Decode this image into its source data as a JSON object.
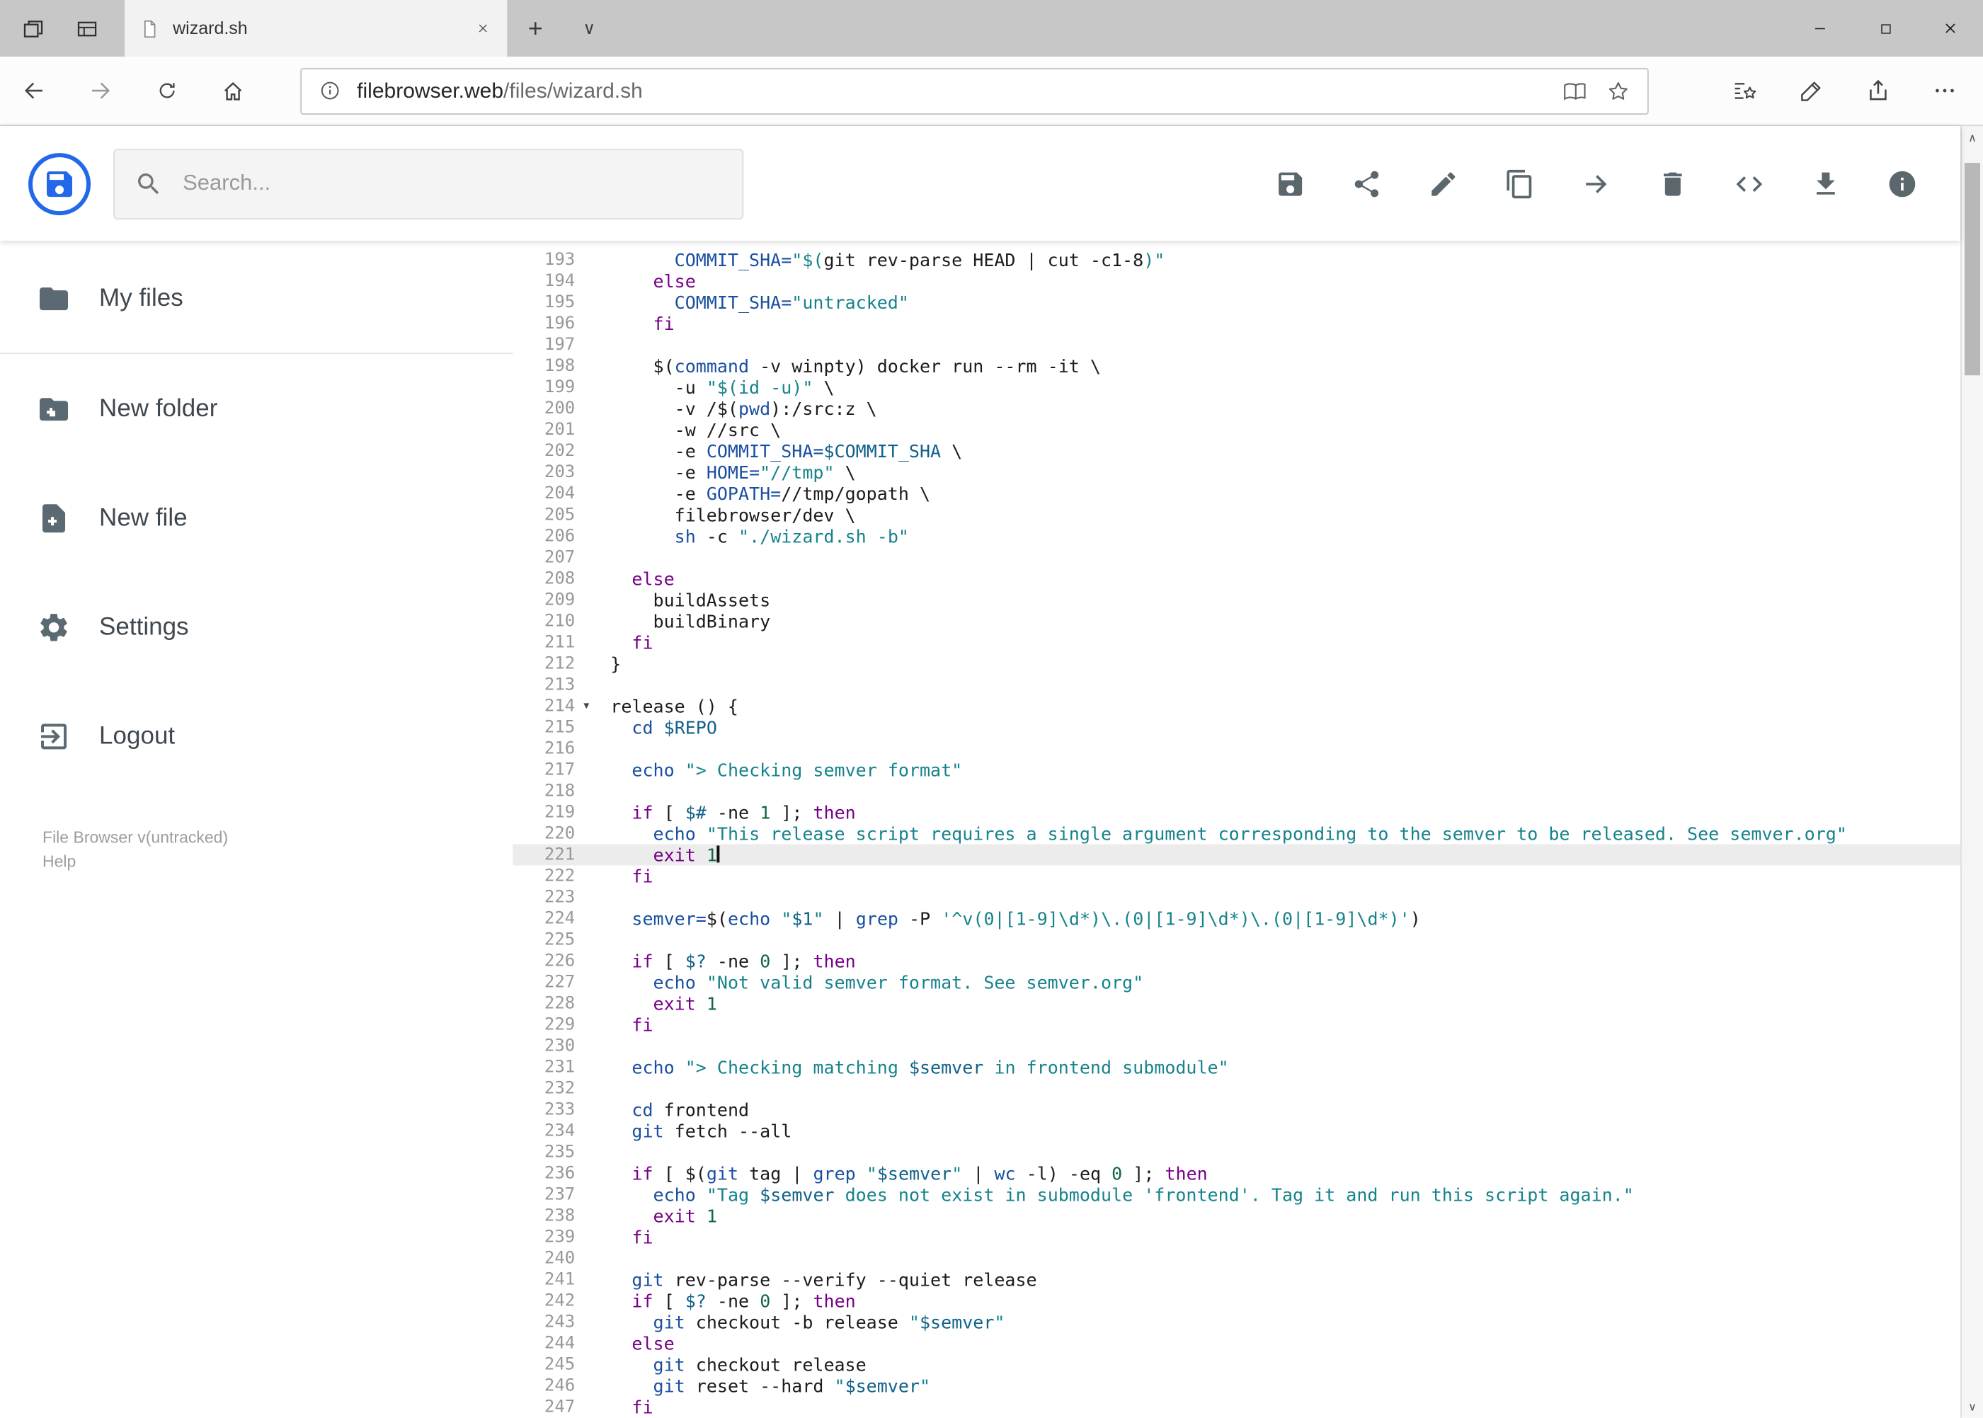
{
  "browser": {
    "tab_title": "wizard.sh",
    "url": {
      "host": "filebrowser.web",
      "path": "/files/wizard.sh"
    }
  },
  "app_colors": {
    "logo_blue": "#2368e8"
  },
  "header": {
    "search_placeholder": "Search...",
    "toolbar": [
      {
        "name": "save",
        "icon": "save"
      },
      {
        "name": "share",
        "icon": "share"
      },
      {
        "name": "edit",
        "icon": "pencil"
      },
      {
        "name": "copy",
        "icon": "copy"
      },
      {
        "name": "move",
        "icon": "move"
      },
      {
        "name": "delete",
        "icon": "trash"
      },
      {
        "name": "source",
        "icon": "code"
      },
      {
        "name": "download",
        "icon": "download"
      },
      {
        "name": "info",
        "icon": "info"
      }
    ]
  },
  "sidebar": {
    "items": [
      {
        "label": "My files",
        "icon": "folder",
        "divider": true
      },
      {
        "label": "New folder",
        "icon": "folderplus"
      },
      {
        "label": "New file",
        "icon": "fileplus"
      },
      {
        "label": "Settings",
        "icon": "gear"
      },
      {
        "label": "Logout",
        "icon": "logout"
      }
    ],
    "footer_version": "File Browser v(untracked)",
    "footer_help": "Help"
  },
  "editor": {
    "active_line": 221,
    "fold_lines": [
      214
    ],
    "colors": {
      "p": "#1c1c1c",
      "k": "#770088",
      "s": "#16838c",
      "v": "#10628a",
      "d": "#1a4fa0",
      "n": "#116644"
    },
    "lines": [
      {
        "n": 193,
        "s": [
          [
            "      ",
            "p"
          ],
          [
            "COMMIT_SHA=",
            "d"
          ],
          [
            "\"$(",
            "s"
          ],
          [
            "git rev-parse HEAD | cut -c1-8",
            "p"
          ],
          [
            ")\"",
            "s"
          ]
        ]
      },
      {
        "n": 194,
        "s": [
          [
            "    ",
            "p"
          ],
          [
            "else",
            "k"
          ]
        ]
      },
      {
        "n": 195,
        "s": [
          [
            "      ",
            "p"
          ],
          [
            "COMMIT_SHA=",
            "d"
          ],
          [
            "\"untracked\"",
            "s"
          ]
        ]
      },
      {
        "n": 196,
        "s": [
          [
            "    ",
            "p"
          ],
          [
            "fi",
            "k"
          ]
        ]
      },
      {
        "n": 197,
        "s": []
      },
      {
        "n": 198,
        "s": [
          [
            "    $(",
            "p"
          ],
          [
            "command",
            "d"
          ],
          [
            " -v winpty) docker run --rm -it \\",
            "p"
          ]
        ]
      },
      {
        "n": 199,
        "s": [
          [
            "      -u ",
            "p"
          ],
          [
            "\"$(id -u)\"",
            "s"
          ],
          [
            " \\",
            "p"
          ]
        ]
      },
      {
        "n": 200,
        "s": [
          [
            "      -v /$(",
            "p"
          ],
          [
            "pwd",
            "d"
          ],
          [
            "):/src:z \\",
            "p"
          ]
        ]
      },
      {
        "n": 201,
        "s": [
          [
            "      -w //src \\",
            "p"
          ]
        ]
      },
      {
        "n": 202,
        "s": [
          [
            "      -e ",
            "p"
          ],
          [
            "COMMIT_SHA=",
            "d"
          ],
          [
            "$COMMIT_SHA",
            "v"
          ],
          [
            " \\",
            "p"
          ]
        ]
      },
      {
        "n": 203,
        "s": [
          [
            "      -e ",
            "p"
          ],
          [
            "HOME=",
            "d"
          ],
          [
            "\"//tmp\"",
            "s"
          ],
          [
            " \\",
            "p"
          ]
        ]
      },
      {
        "n": 204,
        "s": [
          [
            "      -e ",
            "p"
          ],
          [
            "GOPATH=",
            "d"
          ],
          [
            "//tmp/gopath \\",
            "p"
          ]
        ]
      },
      {
        "n": 205,
        "s": [
          [
            "      filebrowser/dev \\",
            "p"
          ]
        ]
      },
      {
        "n": 206,
        "s": [
          [
            "      ",
            "p"
          ],
          [
            "sh",
            "d"
          ],
          [
            " -c ",
            "p"
          ],
          [
            "\"./wizard.sh -b\"",
            "s"
          ]
        ]
      },
      {
        "n": 207,
        "s": []
      },
      {
        "n": 208,
        "s": [
          [
            "  ",
            "p"
          ],
          [
            "else",
            "k"
          ]
        ]
      },
      {
        "n": 209,
        "s": [
          [
            "    buildAssets",
            "p"
          ]
        ]
      },
      {
        "n": 210,
        "s": [
          [
            "    buildBinary",
            "p"
          ]
        ]
      },
      {
        "n": 211,
        "s": [
          [
            "  ",
            "p"
          ],
          [
            "fi",
            "k"
          ]
        ]
      },
      {
        "n": 212,
        "s": [
          [
            "}",
            "p"
          ]
        ]
      },
      {
        "n": 213,
        "s": []
      },
      {
        "n": 214,
        "s": [
          [
            "release () {",
            "p"
          ]
        ]
      },
      {
        "n": 215,
        "s": [
          [
            "  ",
            "p"
          ],
          [
            "cd",
            "d"
          ],
          [
            " ",
            "p"
          ],
          [
            "$REPO",
            "v"
          ]
        ]
      },
      {
        "n": 216,
        "s": []
      },
      {
        "n": 217,
        "s": [
          [
            "  ",
            "p"
          ],
          [
            "echo",
            "d"
          ],
          [
            " ",
            "p"
          ],
          [
            "\"> Checking semver format\"",
            "s"
          ]
        ]
      },
      {
        "n": 218,
        "s": []
      },
      {
        "n": 219,
        "s": [
          [
            "  ",
            "p"
          ],
          [
            "if",
            "k"
          ],
          [
            " [ ",
            "p"
          ],
          [
            "$#",
            "v"
          ],
          [
            " -ne ",
            "p"
          ],
          [
            "1",
            "n"
          ],
          [
            " ]; ",
            "p"
          ],
          [
            "then",
            "k"
          ]
        ]
      },
      {
        "n": 220,
        "s": [
          [
            "    ",
            "p"
          ],
          [
            "echo",
            "d"
          ],
          [
            " ",
            "p"
          ],
          [
            "\"This release script requires a single argument corresponding to the semver to be released. See semver.org\"",
            "s"
          ]
        ]
      },
      {
        "n": 221,
        "s": [
          [
            "    ",
            "p"
          ],
          [
            "exit",
            "k"
          ],
          [
            " ",
            "p"
          ],
          [
            "1",
            "n"
          ]
        ]
      },
      {
        "n": 222,
        "s": [
          [
            "  ",
            "p"
          ],
          [
            "fi",
            "k"
          ]
        ]
      },
      {
        "n": 223,
        "s": []
      },
      {
        "n": 224,
        "s": [
          [
            "  ",
            "p"
          ],
          [
            "semver=",
            "d"
          ],
          [
            "$(",
            "p"
          ],
          [
            "echo",
            "d"
          ],
          [
            " ",
            "p"
          ],
          [
            "\"",
            "s"
          ],
          [
            "$1",
            "v"
          ],
          [
            "\"",
            "s"
          ],
          [
            " | ",
            "p"
          ],
          [
            "grep",
            "d"
          ],
          [
            " -P ",
            "p"
          ],
          [
            "'^v(0|[1-9]\\d*)\\.(0|[1-9]\\d*)\\.(0|[1-9]\\d*)'",
            "s"
          ],
          [
            ")",
            "p"
          ]
        ]
      },
      {
        "n": 225,
        "s": []
      },
      {
        "n": 226,
        "s": [
          [
            "  ",
            "p"
          ],
          [
            "if",
            "k"
          ],
          [
            " [ ",
            "p"
          ],
          [
            "$?",
            "v"
          ],
          [
            " -ne ",
            "p"
          ],
          [
            "0",
            "n"
          ],
          [
            " ]; ",
            "p"
          ],
          [
            "then",
            "k"
          ]
        ]
      },
      {
        "n": 227,
        "s": [
          [
            "    ",
            "p"
          ],
          [
            "echo",
            "d"
          ],
          [
            " ",
            "p"
          ],
          [
            "\"Not valid semver format. See semver.org\"",
            "s"
          ]
        ]
      },
      {
        "n": 228,
        "s": [
          [
            "    ",
            "p"
          ],
          [
            "exit",
            "k"
          ],
          [
            " ",
            "p"
          ],
          [
            "1",
            "n"
          ]
        ]
      },
      {
        "n": 229,
        "s": [
          [
            "  ",
            "p"
          ],
          [
            "fi",
            "k"
          ]
        ]
      },
      {
        "n": 230,
        "s": []
      },
      {
        "n": 231,
        "s": [
          [
            "  ",
            "p"
          ],
          [
            "echo",
            "d"
          ],
          [
            " ",
            "p"
          ],
          [
            "\"> Checking matching ",
            "s"
          ],
          [
            "$semver",
            "v"
          ],
          [
            " in frontend submodule\"",
            "s"
          ]
        ]
      },
      {
        "n": 232,
        "s": []
      },
      {
        "n": 233,
        "s": [
          [
            "  ",
            "p"
          ],
          [
            "cd",
            "d"
          ],
          [
            " frontend",
            "p"
          ]
        ]
      },
      {
        "n": 234,
        "s": [
          [
            "  ",
            "p"
          ],
          [
            "git",
            "d"
          ],
          [
            " fetch --all",
            "p"
          ]
        ]
      },
      {
        "n": 235,
        "s": []
      },
      {
        "n": 236,
        "s": [
          [
            "  ",
            "p"
          ],
          [
            "if",
            "k"
          ],
          [
            " [ $(",
            "p"
          ],
          [
            "git",
            "d"
          ],
          [
            " tag | ",
            "p"
          ],
          [
            "grep",
            "d"
          ],
          [
            " ",
            "p"
          ],
          [
            "\"",
            "s"
          ],
          [
            "$semver",
            "v"
          ],
          [
            "\"",
            "s"
          ],
          [
            " | ",
            "p"
          ],
          [
            "wc",
            "d"
          ],
          [
            " -l) -eq ",
            "p"
          ],
          [
            "0",
            "n"
          ],
          [
            " ]; ",
            "p"
          ],
          [
            "then",
            "k"
          ]
        ]
      },
      {
        "n": 237,
        "s": [
          [
            "    ",
            "p"
          ],
          [
            "echo",
            "d"
          ],
          [
            " ",
            "p"
          ],
          [
            "\"Tag ",
            "s"
          ],
          [
            "$semver",
            "v"
          ],
          [
            " does not exist in submodule 'frontend'. Tag it and run this script again.\"",
            "s"
          ]
        ]
      },
      {
        "n": 238,
        "s": [
          [
            "    ",
            "p"
          ],
          [
            "exit",
            "k"
          ],
          [
            " ",
            "p"
          ],
          [
            "1",
            "n"
          ]
        ]
      },
      {
        "n": 239,
        "s": [
          [
            "  ",
            "p"
          ],
          [
            "fi",
            "k"
          ]
        ]
      },
      {
        "n": 240,
        "s": []
      },
      {
        "n": 241,
        "s": [
          [
            "  ",
            "p"
          ],
          [
            "git",
            "d"
          ],
          [
            " rev-parse --verify --quiet release",
            "p"
          ]
        ]
      },
      {
        "n": 242,
        "s": [
          [
            "  ",
            "p"
          ],
          [
            "if",
            "k"
          ],
          [
            " [ ",
            "p"
          ],
          [
            "$?",
            "v"
          ],
          [
            " -ne ",
            "p"
          ],
          [
            "0",
            "n"
          ],
          [
            " ]; ",
            "p"
          ],
          [
            "then",
            "k"
          ]
        ]
      },
      {
        "n": 243,
        "s": [
          [
            "    ",
            "p"
          ],
          [
            "git",
            "d"
          ],
          [
            " checkout -b release ",
            "p"
          ],
          [
            "\"",
            "s"
          ],
          [
            "$semver",
            "v"
          ],
          [
            "\"",
            "s"
          ]
        ]
      },
      {
        "n": 244,
        "s": [
          [
            "  ",
            "p"
          ],
          [
            "else",
            "k"
          ]
        ]
      },
      {
        "n": 245,
        "s": [
          [
            "    ",
            "p"
          ],
          [
            "git",
            "d"
          ],
          [
            " checkout release",
            "p"
          ]
        ]
      },
      {
        "n": 246,
        "s": [
          [
            "    ",
            "p"
          ],
          [
            "git",
            "d"
          ],
          [
            " reset --hard ",
            "p"
          ],
          [
            "\"",
            "s"
          ],
          [
            "$semver",
            "v"
          ],
          [
            "\"",
            "s"
          ]
        ]
      },
      {
        "n": 247,
        "s": [
          [
            "  ",
            "p"
          ],
          [
            "fi",
            "k"
          ]
        ]
      }
    ]
  }
}
